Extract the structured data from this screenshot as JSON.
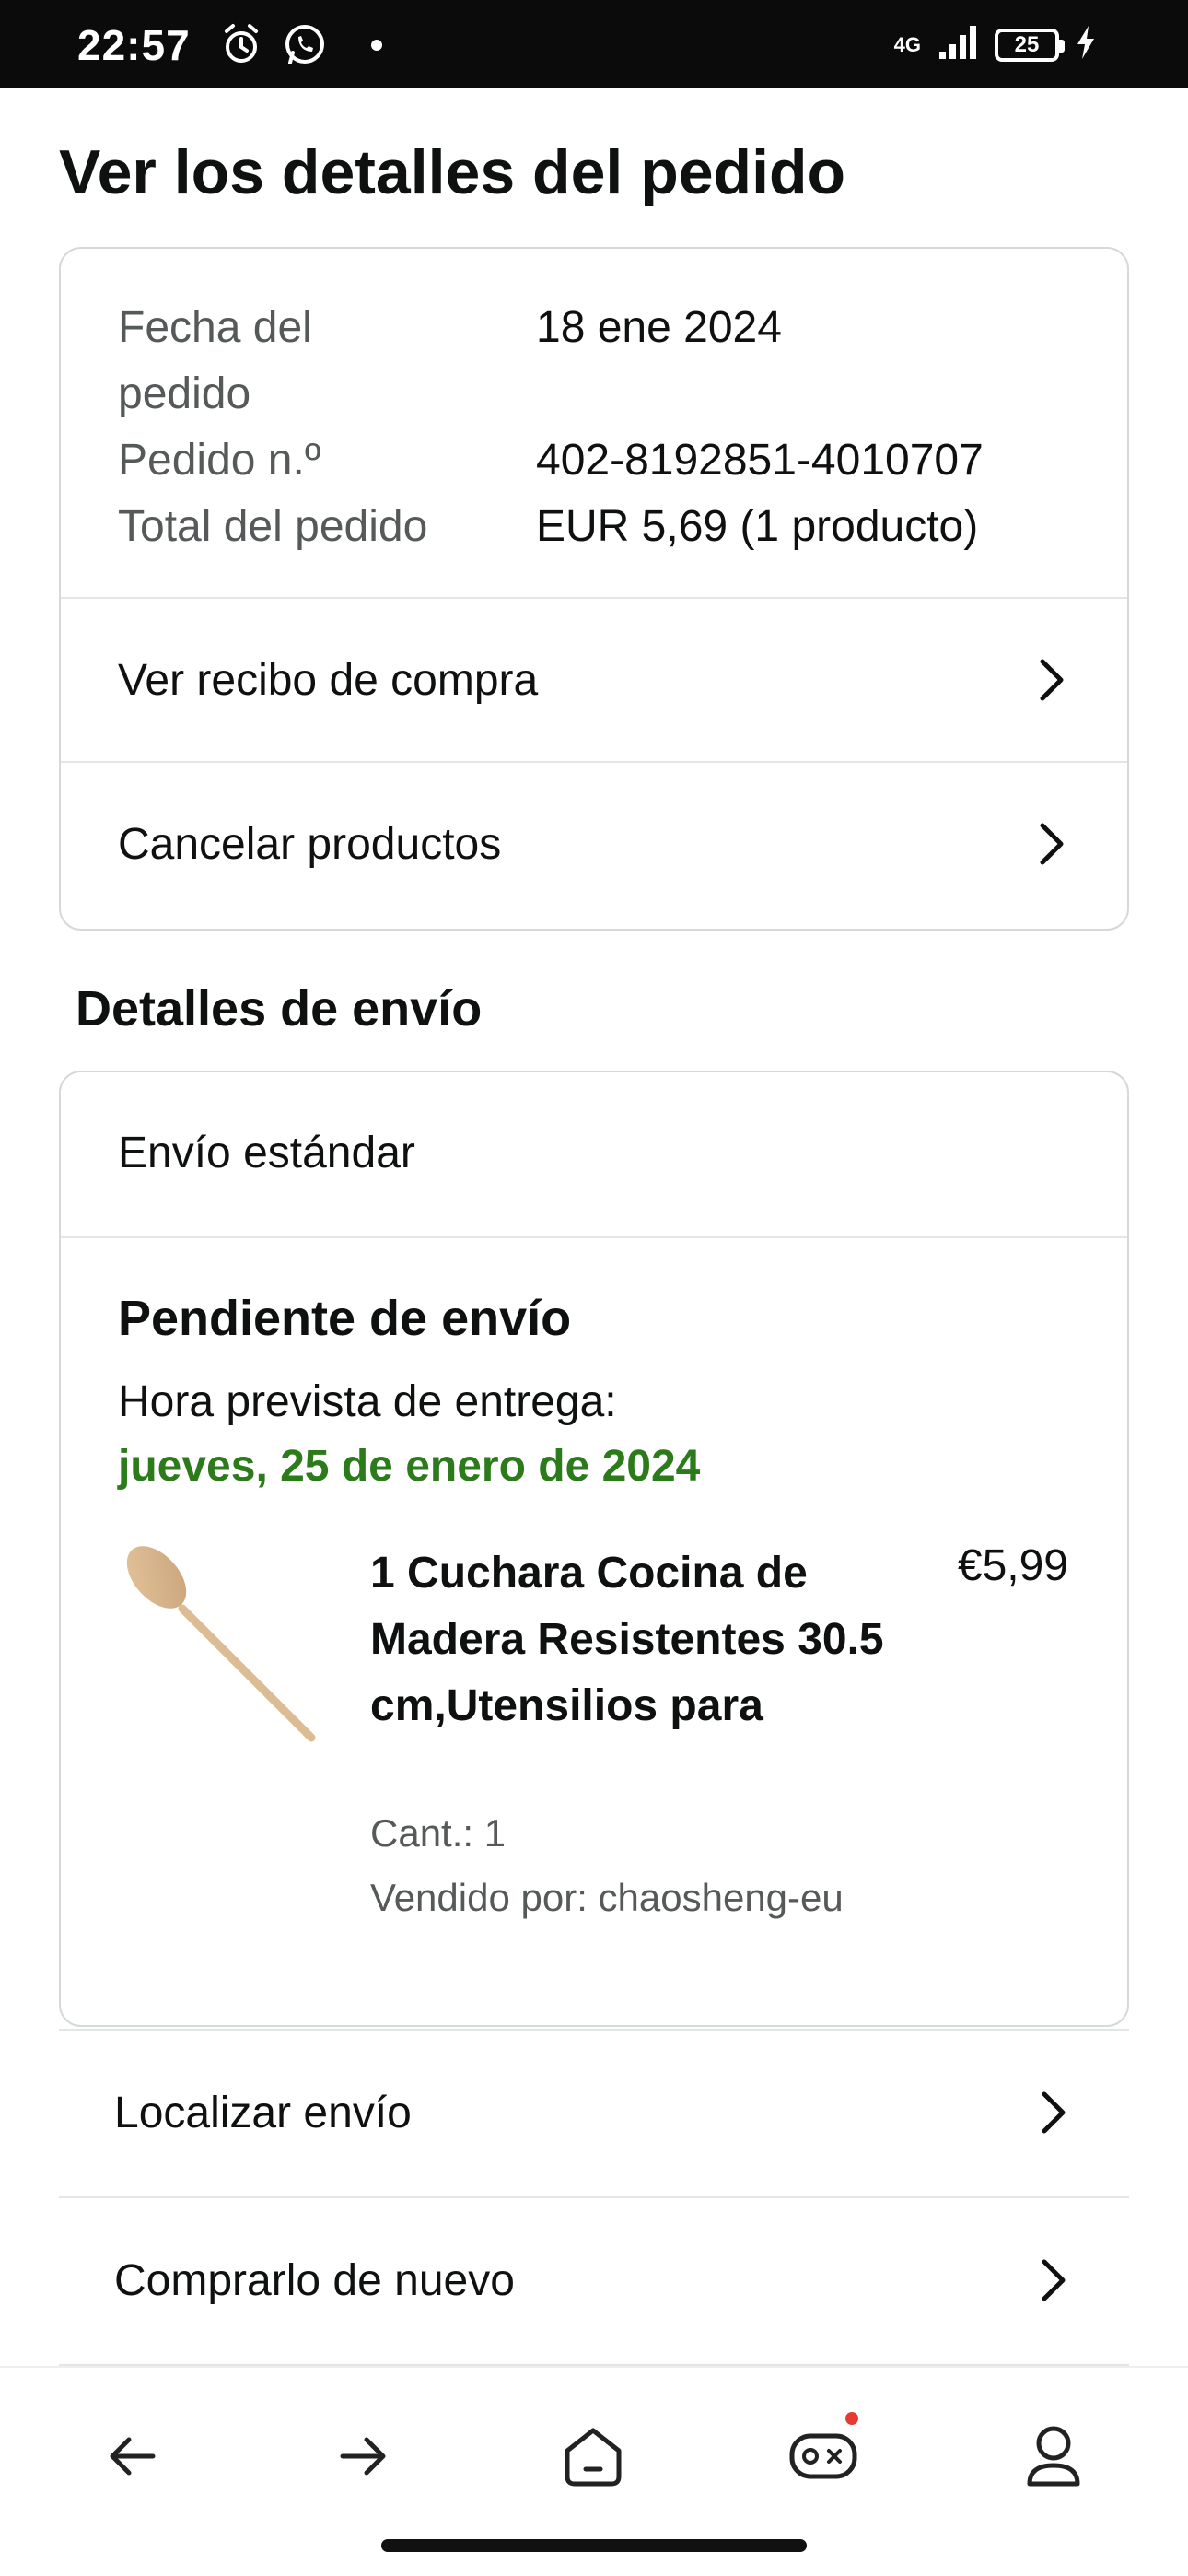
{
  "status_bar": {
    "time": "22:57",
    "network": "4G",
    "battery": "25",
    "icons": [
      "alarm-icon",
      "whatsapp-icon",
      "notification-dot",
      "signal-icon",
      "battery-icon",
      "charging-icon"
    ]
  },
  "page": {
    "title": "Ver los detalles del pedido"
  },
  "order_summary": {
    "rows": [
      {
        "label": "Fecha del pedido",
        "value": "18 ene 2024"
      },
      {
        "label": "Pedido n.º",
        "value": "402-8192851-4010707"
      },
      {
        "label": "Total del pedido",
        "value": "EUR 5,69 (1 producto)"
      }
    ],
    "links": [
      {
        "label": "Ver recibo de compra"
      },
      {
        "label": "Cancelar productos"
      }
    ]
  },
  "shipping": {
    "section_title": "Detalles de envío",
    "method": "Envío estándar",
    "status": "Pendiente de envío",
    "eta_label": "Hora prevista de entrega:",
    "eta_date": "jueves, 25 de enero de 2024",
    "eta_color": "#2c7b1b",
    "product": {
      "title": "1 Cuchara Cocina de Madera Resistentes 30.5 cm,Utensilios para",
      "price": "€5,99",
      "quantity": "Cant.: 1",
      "seller": "Vendido por: chaosheng-eu",
      "image": "wooden-spoon"
    }
  },
  "actions": [
    {
      "label": "Localizar envío"
    },
    {
      "label": "Comprarlo de nuevo"
    }
  ],
  "bottom_nav": {
    "items": [
      "back-arrow-icon",
      "forward-arrow-icon",
      "home-icon",
      "game-icon",
      "account-icon"
    ],
    "notification_color": "#e53935"
  }
}
